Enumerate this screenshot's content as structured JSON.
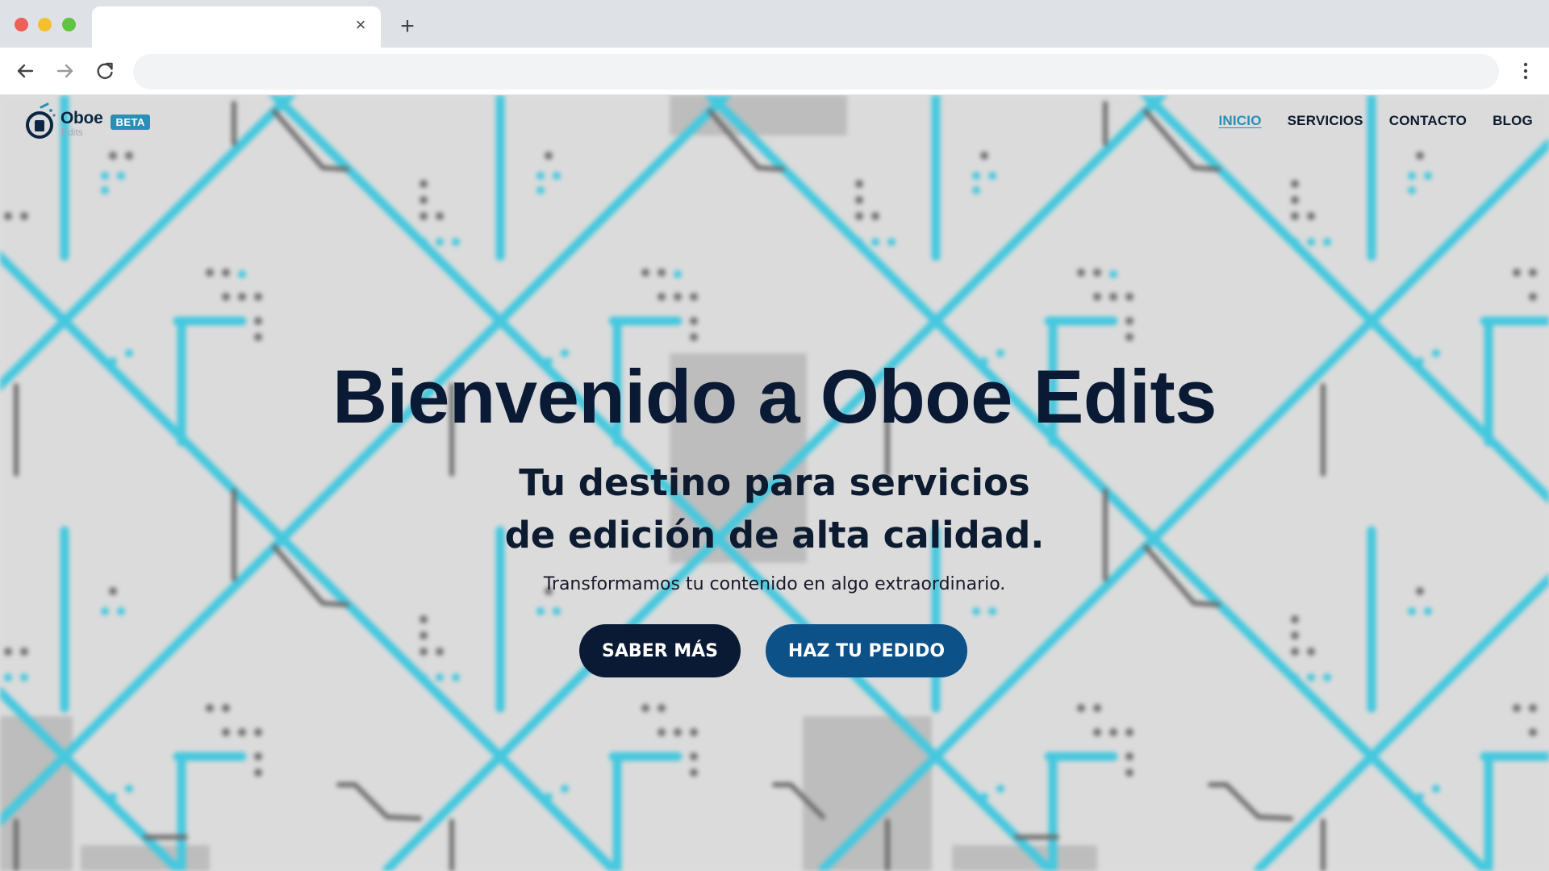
{
  "browser": {
    "tab_title": "",
    "tab_close": "×",
    "new_tab": "+",
    "address": ""
  },
  "site": {
    "logo_name": "Oboe",
    "logo_sub": "Edits",
    "badge": "BETA",
    "nav": [
      {
        "label": "INICIO",
        "active": true
      },
      {
        "label": "SERVICIOS",
        "active": false
      },
      {
        "label": "CONTACTO",
        "active": false
      },
      {
        "label": "BLOG",
        "active": false
      }
    ]
  },
  "hero": {
    "title": "Bienvenido a Oboe Edits",
    "subtitle_line1": "Tu destino para servicios",
    "subtitle_line2": "de edición de alta calidad.",
    "description": "Transformamos tu contenido en algo extraordinario.",
    "primary_button": "SABER MÁS",
    "secondary_button": "HAZ TU PEDIDO"
  },
  "colors": {
    "accent": "#2a8fb4",
    "navy": "#0a1a35",
    "button_blue": "#0d5189",
    "pattern_cyan": "#45c8de"
  },
  "icons": {
    "back": "arrow-left-icon",
    "forward": "arrow-right-icon",
    "reload": "reload-icon",
    "menu": "more-vertical-icon",
    "logo": "oboe-logo-icon"
  }
}
